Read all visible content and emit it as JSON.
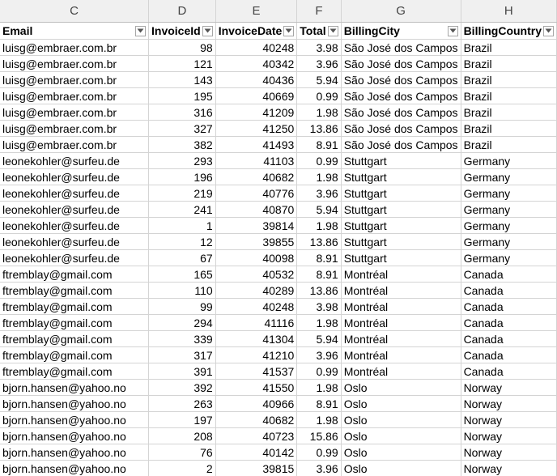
{
  "column_letters": [
    "C",
    "D",
    "E",
    "F",
    "G",
    "H"
  ],
  "headers": [
    "Email",
    "InvoiceId",
    "InvoiceDate",
    "Total",
    "BillingCity",
    "BillingCountry"
  ],
  "icons": {
    "filter": "dropdown-arrow-icon"
  },
  "rows": [
    [
      "luisg@embraer.com.br",
      "98",
      "40248",
      "3.98",
      "São José dos Campos",
      "Brazil"
    ],
    [
      "luisg@embraer.com.br",
      "121",
      "40342",
      "3.96",
      "São José dos Campos",
      "Brazil"
    ],
    [
      "luisg@embraer.com.br",
      "143",
      "40436",
      "5.94",
      "São José dos Campos",
      "Brazil"
    ],
    [
      "luisg@embraer.com.br",
      "195",
      "40669",
      "0.99",
      "São José dos Campos",
      "Brazil"
    ],
    [
      "luisg@embraer.com.br",
      "316",
      "41209",
      "1.98",
      "São José dos Campos",
      "Brazil"
    ],
    [
      "luisg@embraer.com.br",
      "327",
      "41250",
      "13.86",
      "São José dos Campos",
      "Brazil"
    ],
    [
      "luisg@embraer.com.br",
      "382",
      "41493",
      "8.91",
      "São José dos Campos",
      "Brazil"
    ],
    [
      "leonekohler@surfeu.de",
      "293",
      "41103",
      "0.99",
      "Stuttgart",
      "Germany"
    ],
    [
      "leonekohler@surfeu.de",
      "196",
      "40682",
      "1.98",
      "Stuttgart",
      "Germany"
    ],
    [
      "leonekohler@surfeu.de",
      "219",
      "40776",
      "3.96",
      "Stuttgart",
      "Germany"
    ],
    [
      "leonekohler@surfeu.de",
      "241",
      "40870",
      "5.94",
      "Stuttgart",
      "Germany"
    ],
    [
      "leonekohler@surfeu.de",
      "1",
      "39814",
      "1.98",
      "Stuttgart",
      "Germany"
    ],
    [
      "leonekohler@surfeu.de",
      "12",
      "39855",
      "13.86",
      "Stuttgart",
      "Germany"
    ],
    [
      "leonekohler@surfeu.de",
      "67",
      "40098",
      "8.91",
      "Stuttgart",
      "Germany"
    ],
    [
      "ftremblay@gmail.com",
      "165",
      "40532",
      "8.91",
      "Montréal",
      "Canada"
    ],
    [
      "ftremblay@gmail.com",
      "110",
      "40289",
      "13.86",
      "Montréal",
      "Canada"
    ],
    [
      "ftremblay@gmail.com",
      "99",
      "40248",
      "3.98",
      "Montréal",
      "Canada"
    ],
    [
      "ftremblay@gmail.com",
      "294",
      "41116",
      "1.98",
      "Montréal",
      "Canada"
    ],
    [
      "ftremblay@gmail.com",
      "339",
      "41304",
      "5.94",
      "Montréal",
      "Canada"
    ],
    [
      "ftremblay@gmail.com",
      "317",
      "41210",
      "3.96",
      "Montréal",
      "Canada"
    ],
    [
      "ftremblay@gmail.com",
      "391",
      "41537",
      "0.99",
      "Montréal",
      "Canada"
    ],
    [
      "bjorn.hansen@yahoo.no",
      "392",
      "41550",
      "1.98",
      "Oslo",
      "Norway"
    ],
    [
      "bjorn.hansen@yahoo.no",
      "263",
      "40966",
      "8.91",
      "Oslo",
      "Norway"
    ],
    [
      "bjorn.hansen@yahoo.no",
      "197",
      "40682",
      "1.98",
      "Oslo",
      "Norway"
    ],
    [
      "bjorn.hansen@yahoo.no",
      "208",
      "40723",
      "15.86",
      "Oslo",
      "Norway"
    ],
    [
      "bjorn.hansen@yahoo.no",
      "76",
      "40142",
      "0.99",
      "Oslo",
      "Norway"
    ],
    [
      "bjorn.hansen@yahoo.no",
      "2",
      "39815",
      "3.96",
      "Oslo",
      "Norway"
    ]
  ]
}
